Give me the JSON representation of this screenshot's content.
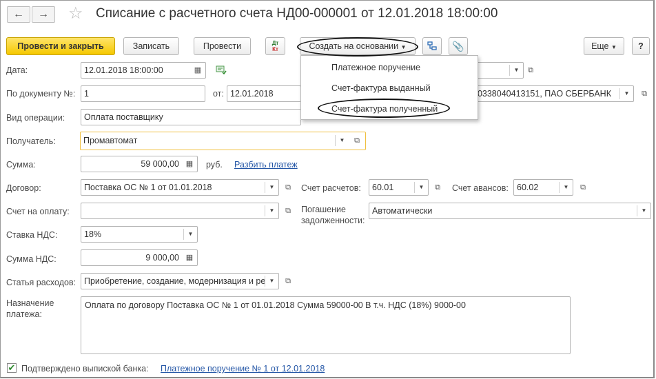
{
  "window": {
    "title": "Списание с расчетного счета НД00-000001 от 12.01.2018 18:00:00",
    "nav_back": "←",
    "nav_forward": "→",
    "star": "☆"
  },
  "toolbar": {
    "post_close": "Провести и закрыть",
    "save": "Записать",
    "post": "Провести",
    "dtkt_top": "Дт",
    "dtkt_bottom": "Кт",
    "create_based": "Создать на основании",
    "more": "Еще",
    "help": "?"
  },
  "dropdown": {
    "items": [
      "Платежное поручение",
      "Счет-фактура выданный",
      "Счет-фактура полученный"
    ]
  },
  "form": {
    "date_label": "Дата:",
    "date_value": "12.01.2018 18:00:00",
    "doc_no_label": "По документу №:",
    "doc_no_value": "1",
    "from_label": "от:",
    "from_value": "12.01.2018",
    "bank_account_value": "10338040413151, ПАО СБЕРБАНК",
    "operation_label": "Вид операции:",
    "operation_value": "Оплата поставщику",
    "recipient_label": "Получатель:",
    "recipient_value": "Промавтомат",
    "sum_label": "Сумма:",
    "sum_value": "59 000,00",
    "currency": "руб.",
    "split_link": "Разбить платеж",
    "contract_label": "Договор:",
    "contract_value": "Поставка ОС № 1 от 01.01.2018",
    "settle_acc_label": "Счет расчетов:",
    "settle_acc_value": "60.01",
    "advance_acc_label": "Счет авансов:",
    "advance_acc_value": "60.02",
    "invoice_label": "Счет на оплату:",
    "invoice_value": "",
    "repay_label_1": "Погашение",
    "repay_label_2": "задолженности:",
    "repay_value": "Автоматически",
    "vat_rate_label": "Ставка НДС:",
    "vat_rate_value": "18%",
    "vat_sum_label": "Сумма НДС:",
    "vat_sum_value": "9 000,00",
    "expense_label": "Статья расходов:",
    "expense_value": "Приобретение, создание, модернизация и реконструкция",
    "purpose_label_1": "Назначение",
    "purpose_label_2": "платежа:",
    "purpose_value": "Оплата по договору Поставка ОС № 1 от 01.01.2018 Сумма 59000-00 В т.ч. НДС  (18%) 9000-00",
    "confirmed_label": "Подтверждено выпиской банка:",
    "confirmed_checked": "✔",
    "payment_order_link": "Платежное поручение № 1 от 12.01.2018"
  },
  "icons": {
    "calendar": "calendar-icon",
    "dropdown": "chevron-down-icon",
    "open": "open-in-window-icon",
    "attach": "paperclip-icon",
    "structure": "structure-icon",
    "dtkt": "dt-kt-icon",
    "comment": "comment-icon"
  },
  "colors": {
    "primary_button": "#f5c800",
    "link": "#2456a6",
    "focus_border": "#f0c040",
    "check": "#2d8a2d"
  }
}
